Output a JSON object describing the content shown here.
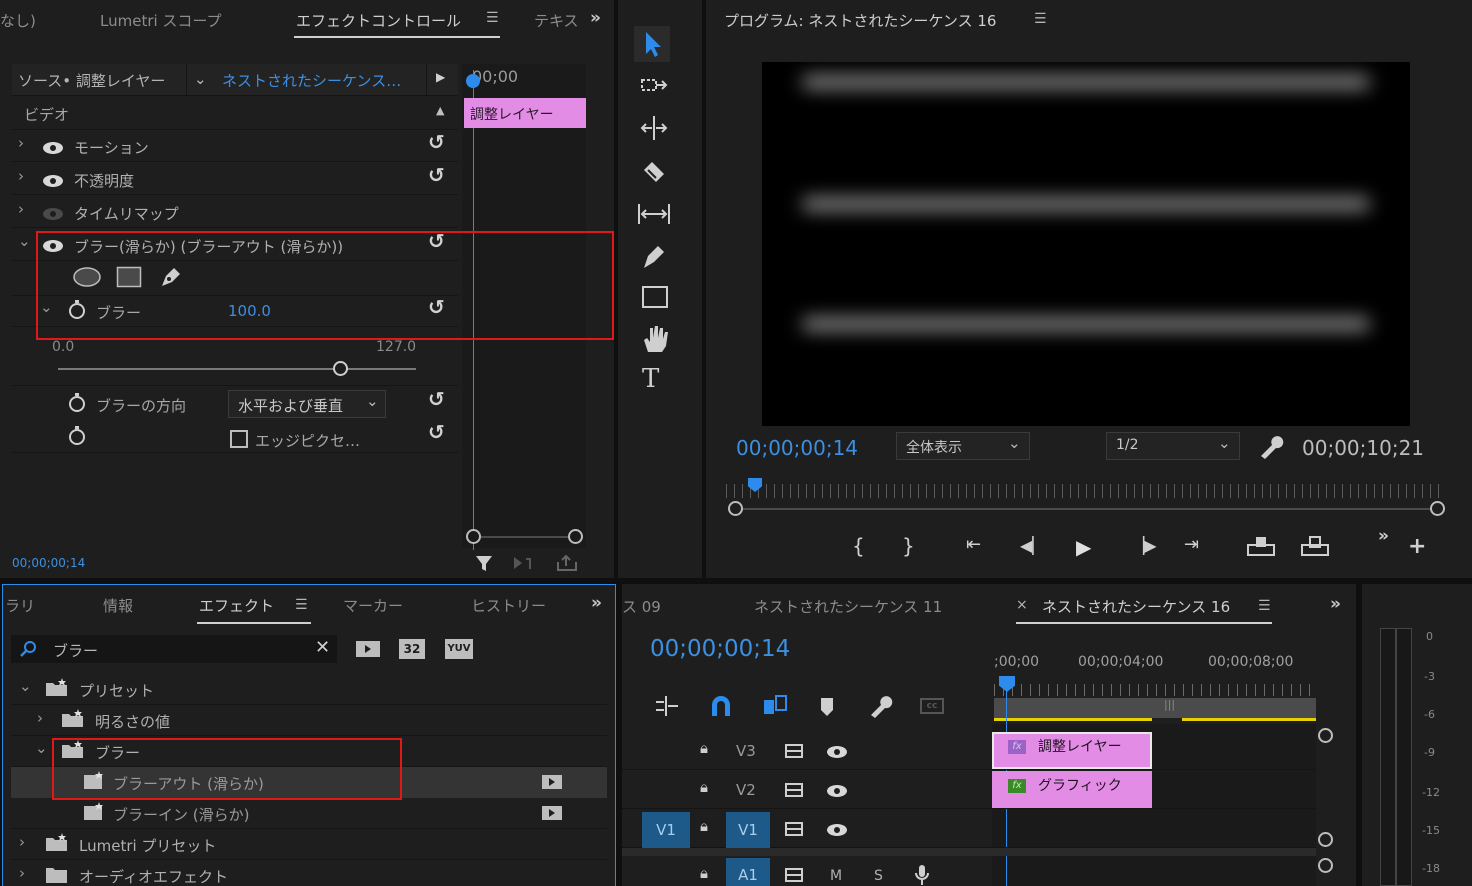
{
  "effect_controls": {
    "tabs": [
      "なし)",
      "Lumetri スコープ",
      "エフェクトコントロール",
      "テキス"
    ],
    "source_label": "ソース• 調整レイヤー",
    "sequence_name": "ネストされたシーケンス…",
    "timecode_head": "00;00",
    "clip_label": "調整レイヤー",
    "section_video": "ビデオ",
    "effects": [
      {
        "label": "モーション"
      },
      {
        "label": "不透明度"
      },
      {
        "label": "タイムリマップ"
      },
      {
        "label": "ブラー(滑らか) (ブラーアウト (滑らか))"
      }
    ],
    "blur_param": "ブラー",
    "blur_value": "100.0",
    "range_min": "0.0",
    "range_max": "127.0",
    "slider_fraction": 0.79,
    "direction_label": "ブラーの方向",
    "direction_value": "水平および垂直",
    "edge_label": "エッジピクセ…",
    "footer_timecode": "00;00;00;14"
  },
  "program": {
    "title": "プログラム: ネストされたシーケンス 16",
    "timecode": "00;00;00;14",
    "zoom": "全体表示",
    "resolution": "1/2",
    "duration": "00;00;10;21"
  },
  "effects_panel": {
    "tabs": [
      "ラリ",
      "情報",
      "エフェクト",
      "マーカー",
      "ヒストリー"
    ],
    "search_value": "ブラー",
    "badges": [
      "32",
      "YUV"
    ],
    "tree": [
      {
        "label": "プリセット"
      },
      {
        "label": "明るさの値"
      },
      {
        "label": "ブラー"
      },
      {
        "label": "ブラーアウト (滑らか)"
      },
      {
        "label": "ブラーイン (滑らか)"
      },
      {
        "label": "Lumetri プリセット"
      },
      {
        "label": "オーディオエフェクト"
      }
    ]
  },
  "timeline": {
    "tabs": [
      "ス 09",
      "ネストされたシーケンス 11",
      "ネストされたシーケンス 16"
    ],
    "close_glyph": "×",
    "timecode": "00;00;00;14",
    "ruler": [
      ";00;00",
      "00;00;04;00",
      "00;00;08;00"
    ],
    "tracks": [
      {
        "name": "V3"
      },
      {
        "name": "V2"
      },
      {
        "name": "V1",
        "source": "V1"
      },
      {
        "name": "A1",
        "m": "M",
        "s": "S"
      }
    ],
    "clips": [
      {
        "label": "調整レイヤー"
      },
      {
        "label": "グラフィック"
      }
    ]
  },
  "meter": {
    "labels": [
      "0",
      "-3",
      "-6",
      "-9",
      "-12",
      "-15",
      "-18"
    ]
  },
  "colors": {
    "accent": "#2d8ceb",
    "clip_pink": "#e38ce6",
    "highlight": "#e01818"
  }
}
